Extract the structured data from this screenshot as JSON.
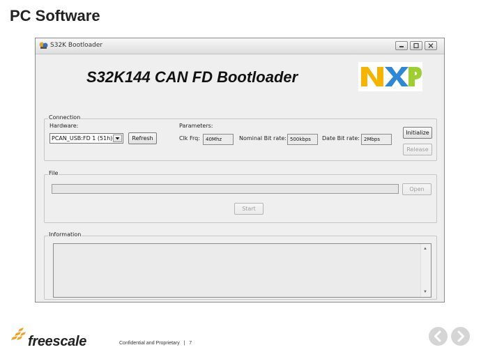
{
  "slide": {
    "title": "PC Software",
    "footer_text": "Confidential and Proprietary",
    "footer_separator": "|",
    "page_number": "7",
    "logo_text": "freescale"
  },
  "window": {
    "title": "S32K Bootloader",
    "controls": [
      "minimize-icon",
      "maximize-icon",
      "close-icon"
    ]
  },
  "app": {
    "heading": "S32K144 CAN FD Bootloader",
    "logo_text": "NXP",
    "logo_colors": [
      "#f4b400",
      "#0b74c4",
      "#9ccf2f"
    ]
  },
  "connection": {
    "group_label": "Connection",
    "hardware_label": "Hardware:",
    "hardware_value": "PCAN_USB:FD 1 (51h)",
    "refresh_label": "Refresh",
    "parameters_label": "Parameters:",
    "clk_label": "Clk Frq:",
    "clk_value": "40Mhz",
    "nominal_label": "Nominal Bit rate:",
    "nominal_value": "500kbps",
    "data_label": "Date Bit rate:",
    "data_value": "2Mbps",
    "initialize_label": "Initialize",
    "release_label": "Release"
  },
  "file": {
    "group_label": "File",
    "open_label": "Open",
    "start_label": "Start",
    "progress": 0
  },
  "information": {
    "group_label": "Information"
  }
}
